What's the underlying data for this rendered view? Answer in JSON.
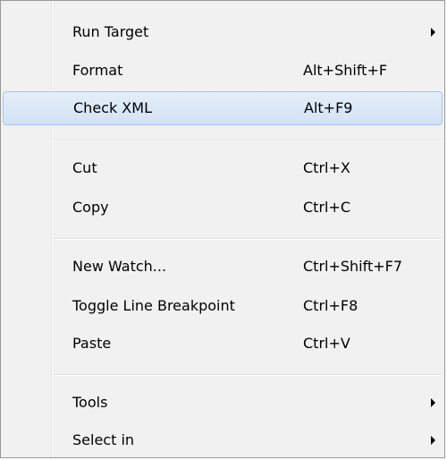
{
  "menu": {
    "items": [
      {
        "label": "Run Target",
        "shortcut": "",
        "submenu": true,
        "icon": "chevron-right-icon"
      },
      {
        "label": "Format",
        "shortcut": "Alt+Shift+F"
      },
      {
        "label": "Check XML",
        "shortcut": "Alt+F9",
        "highlighted": true
      },
      {
        "label": "Cut",
        "shortcut": "Ctrl+X"
      },
      {
        "label": "Copy",
        "shortcut": "Ctrl+C"
      },
      {
        "label": "New Watch...",
        "shortcut": "Ctrl+Shift+F7"
      },
      {
        "label": "Toggle Line Breakpoint",
        "shortcut": "Ctrl+F8"
      },
      {
        "label": "Paste",
        "shortcut": "Ctrl+V"
      },
      {
        "label": "Tools",
        "shortcut": "",
        "submenu": true,
        "icon": "chevron-right-icon"
      },
      {
        "label": "Select in",
        "shortcut": "",
        "submenu": true,
        "icon": "chevron-right-icon"
      }
    ],
    "colors": {
      "background": "#f1f1f1",
      "highlight": "#d3e2f4",
      "highlight_border": "#a8c8eb",
      "border": "#979797"
    }
  }
}
